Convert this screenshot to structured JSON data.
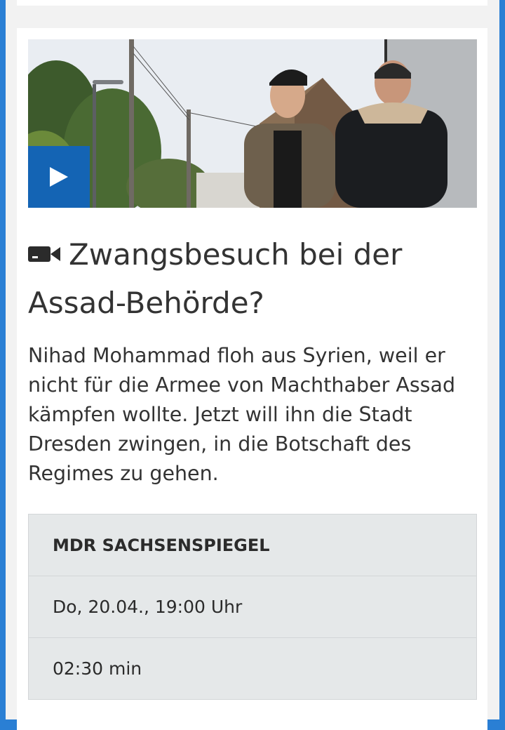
{
  "article": {
    "title": "Zwangsbesuch bei der Assad-Behörde?",
    "teaser": "Nihad Mohammad floh aus Syrien, weil er nicht für die Armee von Machthaber Assad kämpfen wollte. Jetzt will ihn die Stadt Dresden zwingen, in die Botschaft des Regimes zu gehen.",
    "type_icon": "video-camera-icon",
    "play_icon": "play-icon"
  },
  "meta": {
    "program": "MDR SACHSENSPIEGEL",
    "broadcast": "Do, 20.04., 19:00 Uhr",
    "duration": "02:30 min"
  },
  "colors": {
    "frame_accent": "#2a7fd4",
    "play_button": "#1464b4",
    "text": "#333333",
    "meta_background": "#e5e8e9"
  }
}
